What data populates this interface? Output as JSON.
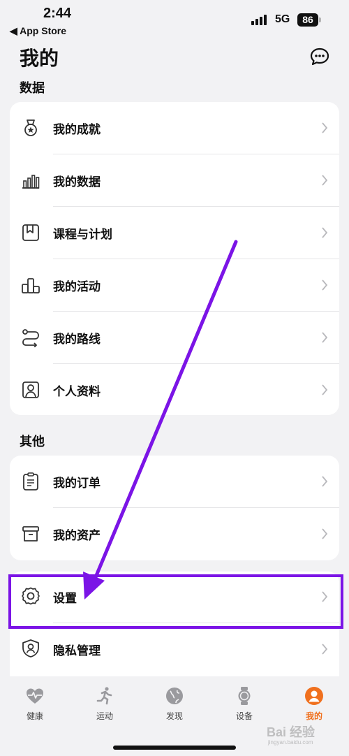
{
  "status_bar": {
    "time": "2:44",
    "back_app": "◀ App Store",
    "network": "5G",
    "battery": "86"
  },
  "header": {
    "title": "我的",
    "icon": "chat-bubble-icon"
  },
  "sections": {
    "data_title": "数据",
    "data_items": [
      {
        "label": "我的成就",
        "icon": "medal-icon"
      },
      {
        "label": "我的数据",
        "icon": "bar-chart-icon"
      },
      {
        "label": "课程与计划",
        "icon": "bookmark-book-icon"
      },
      {
        "label": "我的活动",
        "icon": "podium-icon"
      },
      {
        "label": "我的路线",
        "icon": "route-icon"
      },
      {
        "label": "个人资料",
        "icon": "profile-card-icon"
      }
    ],
    "other_title": "其他",
    "other_items": [
      {
        "label": "我的订单",
        "icon": "clipboard-icon"
      },
      {
        "label": "我的资产",
        "icon": "box-icon"
      }
    ],
    "settings_items": [
      {
        "label": "设置",
        "icon": "gear-icon"
      },
      {
        "label": "隐私管理",
        "icon": "shield-user-icon"
      }
    ]
  },
  "tabs": [
    {
      "label": "健康",
      "icon": "heart-pulse-icon",
      "active": false
    },
    {
      "label": "运动",
      "icon": "running-icon",
      "active": false
    },
    {
      "label": "发现",
      "icon": "globe-icon",
      "active": false
    },
    {
      "label": "设备",
      "icon": "watch-icon",
      "active": false
    },
    {
      "label": "我的",
      "icon": "user-icon",
      "active": true
    }
  ],
  "colors": {
    "accent": "#f0701e",
    "annotation": "#7b14e6",
    "background": "#f2f2f4"
  },
  "watermark": {
    "text": "Bai 经验",
    "sub": "jingyan.baidu.com"
  }
}
